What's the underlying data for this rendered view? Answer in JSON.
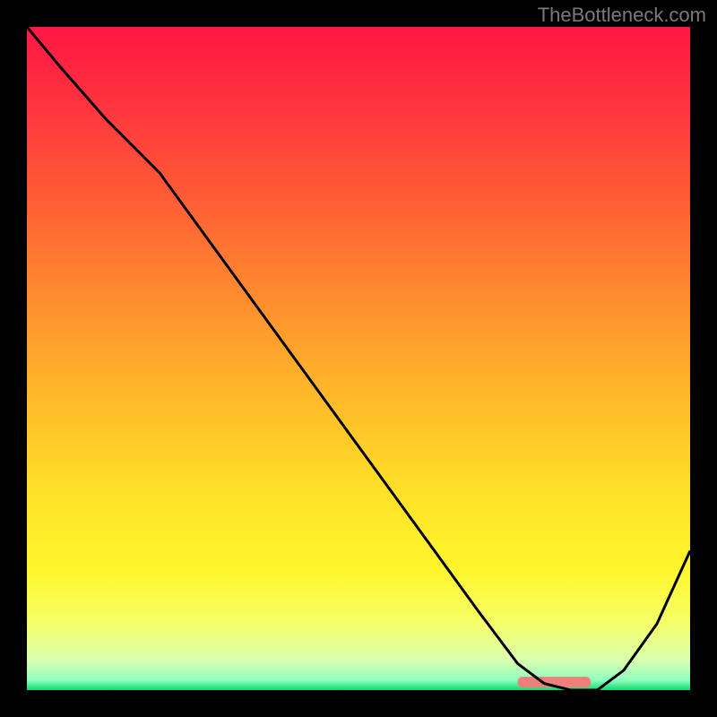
{
  "watermark": "TheBottleneck.com",
  "chart_data": {
    "type": "line",
    "title": "",
    "xlabel": "",
    "ylabel": "",
    "xlim": [
      0,
      100
    ],
    "ylim": [
      0,
      100
    ],
    "x": [
      0,
      5,
      12,
      20,
      28,
      36,
      44,
      52,
      60,
      68,
      74,
      78,
      82,
      86,
      90,
      95,
      100
    ],
    "values": [
      100,
      94,
      86,
      78,
      67,
      56,
      45,
      34,
      23,
      12,
      4,
      1,
      0,
      0,
      3,
      10,
      21
    ],
    "gradient_stops": [
      {
        "pos": 0.0,
        "color": "#ff1744"
      },
      {
        "pos": 0.1,
        "color": "#ff2f3f"
      },
      {
        "pos": 0.25,
        "color": "#ff5a36"
      },
      {
        "pos": 0.4,
        "color": "#ff8a2f"
      },
      {
        "pos": 0.55,
        "color": "#ffb72a"
      },
      {
        "pos": 0.7,
        "color": "#ffe028"
      },
      {
        "pos": 0.82,
        "color": "#fff62d"
      },
      {
        "pos": 0.9,
        "color": "#f6ff6a"
      },
      {
        "pos": 0.955,
        "color": "#d9ffb0"
      },
      {
        "pos": 0.985,
        "color": "#8fffbf"
      },
      {
        "pos": 1.0,
        "color": "#0fd96c"
      }
    ],
    "highlight_bar": {
      "x_start": 74,
      "x_end": 85,
      "y": 1.2,
      "color": "#ef7f7b"
    }
  }
}
